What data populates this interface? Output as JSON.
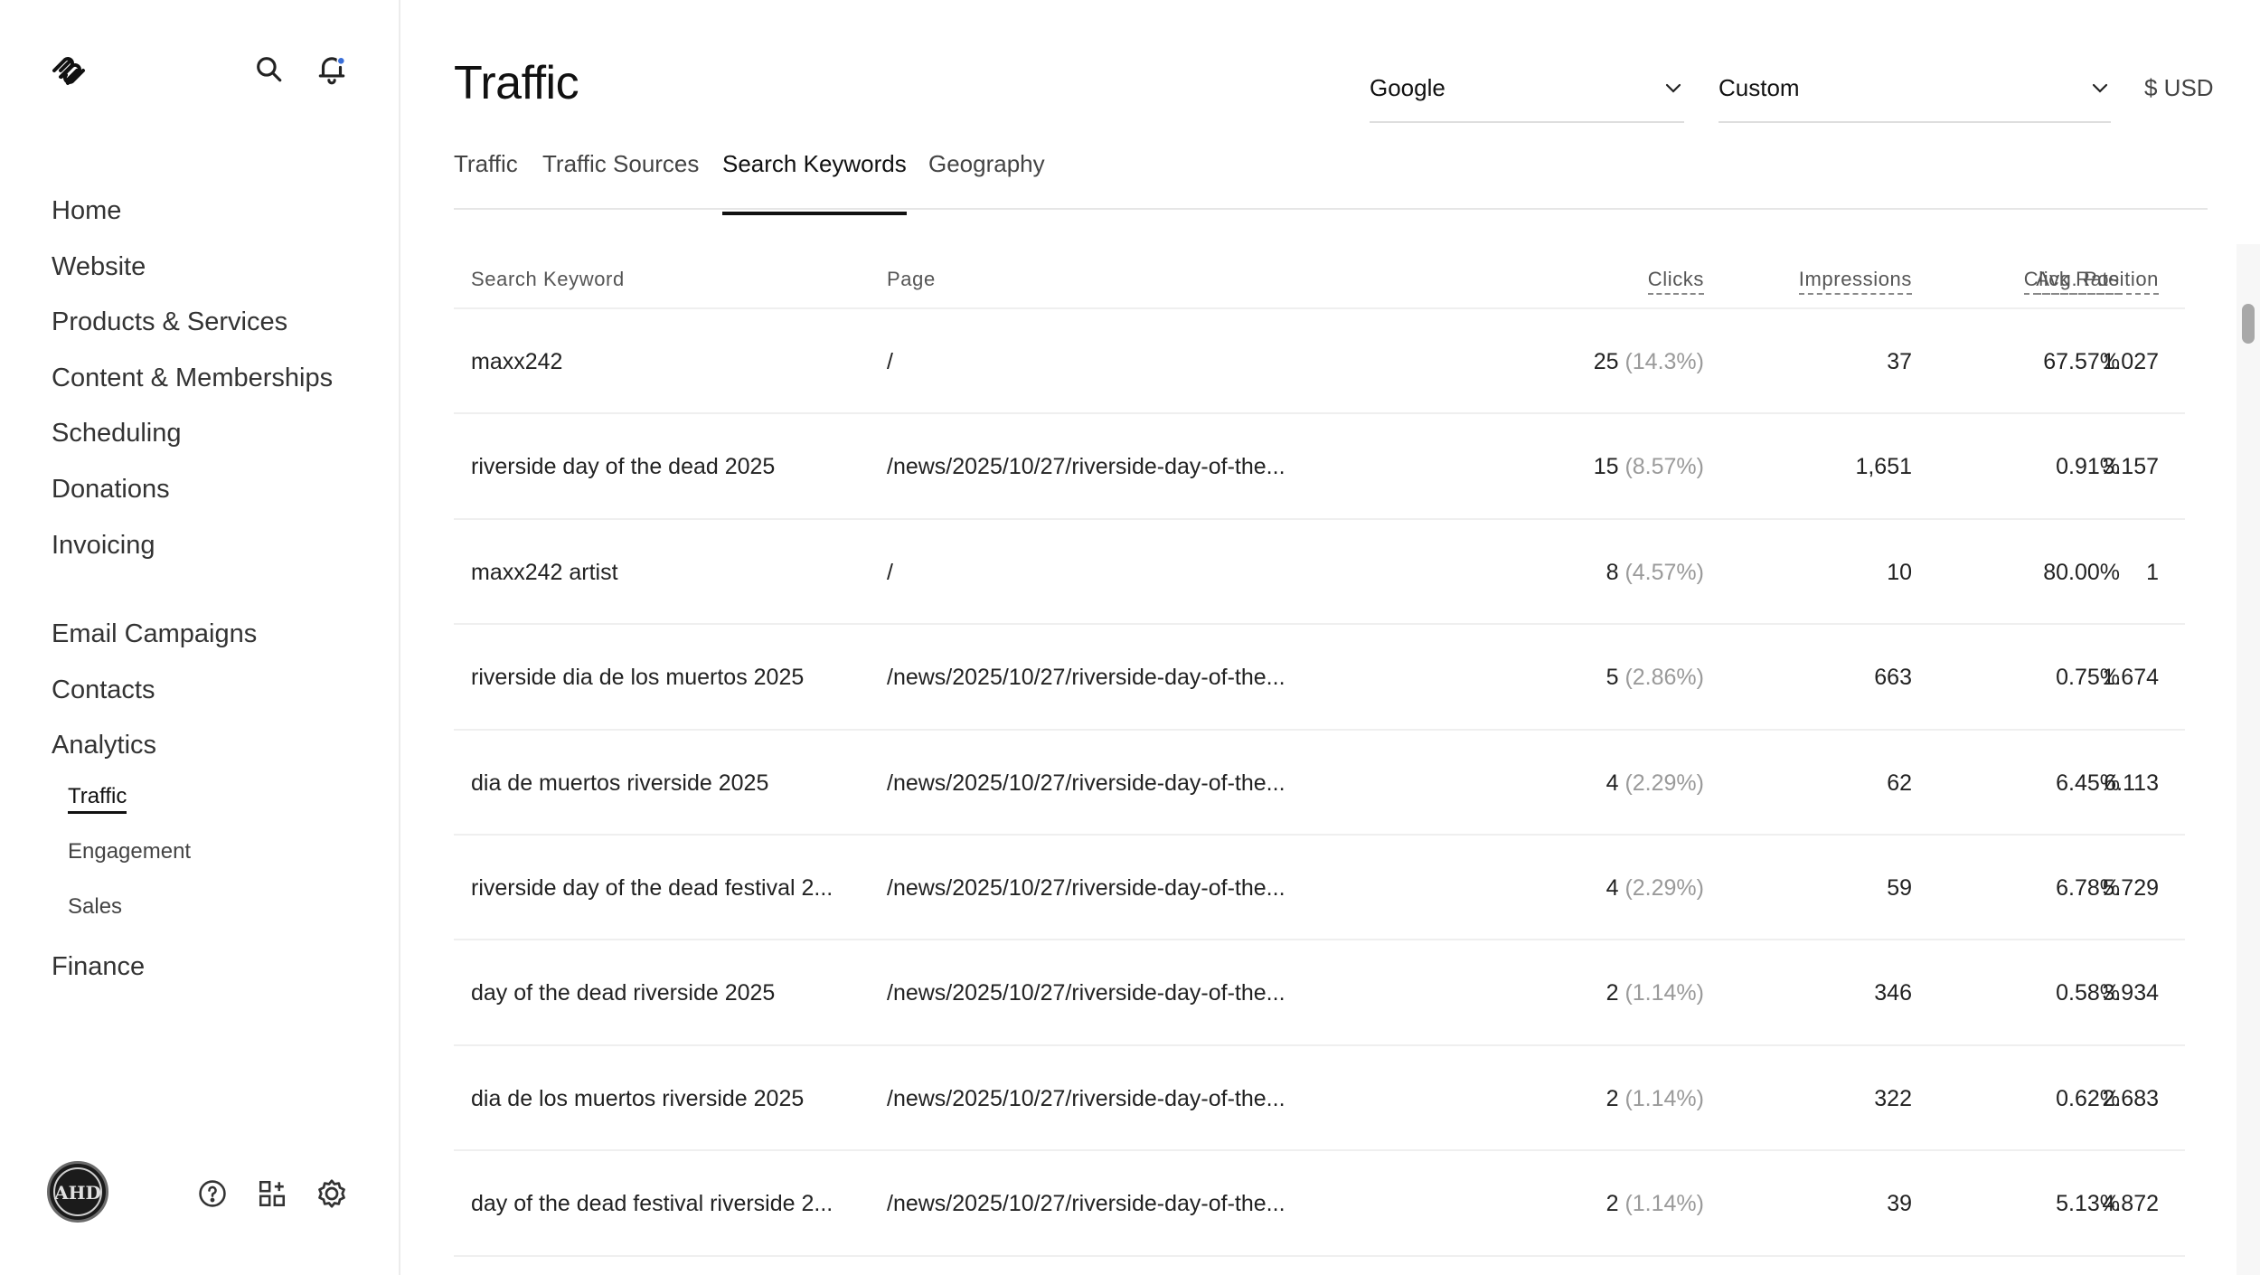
{
  "sidebar": {
    "nav_primary": [
      "Home",
      "Website",
      "Products & Services",
      "Content & Memberships",
      "Scheduling",
      "Donations",
      "Invoicing"
    ],
    "nav_secondary": [
      "Email Campaigns",
      "Contacts",
      "Analytics"
    ],
    "analytics_sub": [
      "Traffic",
      "Engagement",
      "Sales"
    ],
    "finance": "Finance",
    "avatar_initials": "AHD"
  },
  "header": {
    "title": "Traffic",
    "source_dropdown": "Google",
    "range_dropdown": "Custom",
    "currency": "$ USD"
  },
  "tabs": [
    {
      "label": "Traffic",
      "active": false
    },
    {
      "label": "Traffic Sources",
      "active": false
    },
    {
      "label": "Search Keywords",
      "active": true
    },
    {
      "label": "Geography",
      "active": false
    }
  ],
  "table": {
    "columns": [
      "Search Keyword",
      "Page",
      "Clicks",
      "Impressions",
      "Click Rate",
      "Avg. Position"
    ],
    "rows": [
      {
        "keyword": "maxx242",
        "page": "/",
        "clicks": "25",
        "clicks_pct": "(14.3%)",
        "impressions": "37",
        "click_rate": "67.57%",
        "position": "1.027"
      },
      {
        "keyword": "riverside day of the dead 2025",
        "page": "/news/2025/10/27/riverside-day-of-the...",
        "clicks": "15",
        "clicks_pct": "(8.57%)",
        "impressions": "1,651",
        "click_rate": "0.91%",
        "position": "3.157"
      },
      {
        "keyword": "maxx242 artist",
        "page": "/",
        "clicks": "8",
        "clicks_pct": "(4.57%)",
        "impressions": "10",
        "click_rate": "80.00%",
        "position": "1"
      },
      {
        "keyword": "riverside dia de los muertos 2025",
        "page": "/news/2025/10/27/riverside-day-of-the...",
        "clicks": "5",
        "clicks_pct": "(2.86%)",
        "impressions": "663",
        "click_rate": "0.75%",
        "position": "1.674"
      },
      {
        "keyword": "dia de muertos riverside 2025",
        "page": "/news/2025/10/27/riverside-day-of-the...",
        "clicks": "4",
        "clicks_pct": "(2.29%)",
        "impressions": "62",
        "click_rate": "6.45%",
        "position": "6.113"
      },
      {
        "keyword": "riverside day of the dead festival 2...",
        "page": "/news/2025/10/27/riverside-day-of-the...",
        "clicks": "4",
        "clicks_pct": "(2.29%)",
        "impressions": "59",
        "click_rate": "6.78%",
        "position": "5.729"
      },
      {
        "keyword": "day of the dead riverside 2025",
        "page": "/news/2025/10/27/riverside-day-of-the...",
        "clicks": "2",
        "clicks_pct": "(1.14%)",
        "impressions": "346",
        "click_rate": "0.58%",
        "position": "3.934"
      },
      {
        "keyword": "dia de los muertos riverside 2025",
        "page": "/news/2025/10/27/riverside-day-of-the...",
        "clicks": "2",
        "clicks_pct": "(1.14%)",
        "impressions": "322",
        "click_rate": "0.62%",
        "position": "2.683"
      },
      {
        "keyword": "day of the dead festival riverside 2...",
        "page": "/news/2025/10/27/riverside-day-of-the...",
        "clicks": "2",
        "clicks_pct": "(1.14%)",
        "impressions": "39",
        "click_rate": "5.13%",
        "position": "4.872"
      }
    ]
  },
  "colors": {
    "accent_notification": "#3a6fd8",
    "muted_pct": "#9a9a9a",
    "divider": "#efefef"
  },
  "icons": [
    "squarespace-logo-icon",
    "search-icon",
    "bell-icon",
    "help-icon",
    "apps-icon",
    "settings-icon",
    "chevron-down-icon"
  ]
}
